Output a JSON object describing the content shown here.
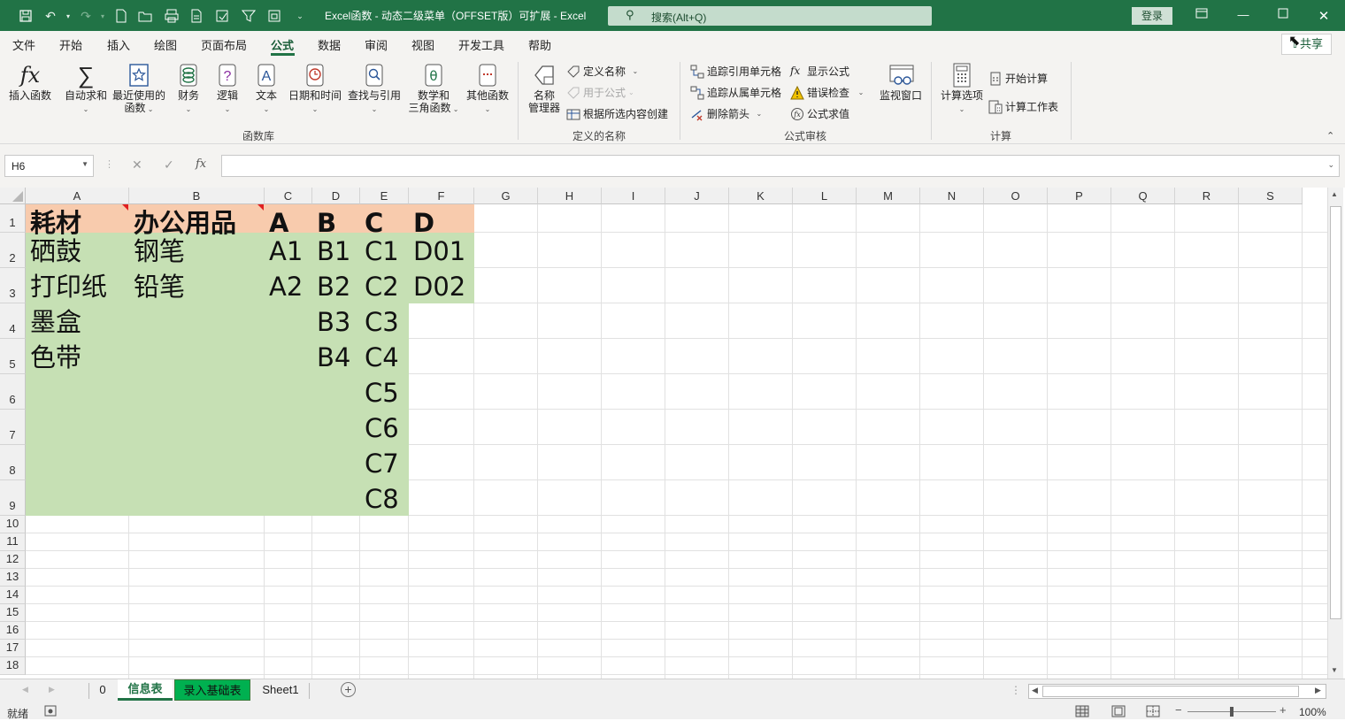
{
  "titlebar": {
    "doc_title": "Excel函数 - 动态二级菜单（OFFSET版）可扩展  -  Excel",
    "search_placeholder": "搜索(Alt+Q)",
    "login_label": "登录"
  },
  "menu": {
    "tabs": [
      "文件",
      "开始",
      "插入",
      "绘图",
      "页面布局",
      "公式",
      "数据",
      "审阅",
      "视图",
      "开发工具",
      "帮助"
    ],
    "active_tab": "公式",
    "share_label": "共享"
  },
  "ribbon": {
    "function_library": {
      "insert_function": "插入函数",
      "autosum": "自动求和",
      "recent_line1": "最近使用的",
      "recent_line2": "函数",
      "financial": "财务",
      "logical": "逻辑",
      "text": "文本",
      "datetime": "日期和时间",
      "lookup": "查找与引用",
      "math_line1": "数学和",
      "math_line2": "三角函数",
      "more": "其他函数",
      "group_label": "函数库"
    },
    "defined_names": {
      "name_manager_line1": "名称",
      "name_manager_line2": "管理器",
      "define_name": "定义名称",
      "use_in_formula": "用于公式",
      "create_from_selection": "根据所选内容创建",
      "group_label": "定义的名称"
    },
    "formula_auditing": {
      "trace_precedents": "追踪引用单元格",
      "trace_dependents": "追踪从属单元格",
      "remove_arrows": "删除箭头",
      "show_formulas": "显示公式",
      "error_checking": "错误检查",
      "evaluate_formula": "公式求值",
      "watch_window": "监视窗口",
      "group_label": "公式审核"
    },
    "calculation": {
      "calc_options": "计算选项",
      "calc_now": "开始计算",
      "calc_sheet": "计算工作表",
      "group_label": "计算"
    }
  },
  "formula_bar": {
    "name_box": "H6",
    "fx_label": "fx",
    "formula": ""
  },
  "grid": {
    "columns": [
      "A",
      "B",
      "C",
      "D",
      "E",
      "F",
      "G",
      "H",
      "I",
      "J",
      "K",
      "L",
      "M",
      "N",
      "O",
      "P",
      "Q",
      "R",
      "S"
    ],
    "rows": [
      "1",
      "2",
      "3",
      "4",
      "5",
      "6",
      "7",
      "8",
      "9",
      "10",
      "11",
      "12",
      "13",
      "14",
      "15",
      "16",
      "17",
      "18"
    ],
    "cells": {
      "header_row": [
        "耗材",
        "办公用品",
        "A",
        "B",
        "C",
        "D"
      ],
      "col_A": [
        "硒鼓",
        "打印纸",
        "墨盒",
        "色带"
      ],
      "col_B": [
        "钢笔",
        "铅笔"
      ],
      "col_C": [
        "A1",
        "A2"
      ],
      "col_D": [
        "B1",
        "B2",
        "B3",
        "B4"
      ],
      "col_E": [
        "C1",
        "C2",
        "C3",
        "C4",
        "C5",
        "C6",
        "C7",
        "C8"
      ],
      "col_F": [
        "D01",
        "D02"
      ]
    },
    "colors": {
      "header_fill": "#f8cbad",
      "data_fill": "#c6e0b4",
      "comment_marker": "#e02020"
    }
  },
  "sheet_tabs": {
    "tabs": [
      "0",
      "信息表",
      "录入基础表",
      "Sheet1"
    ],
    "active": "信息表",
    "green_tab": "录入基础表"
  },
  "status": {
    "ready": "就绪",
    "zoom": "100%"
  }
}
